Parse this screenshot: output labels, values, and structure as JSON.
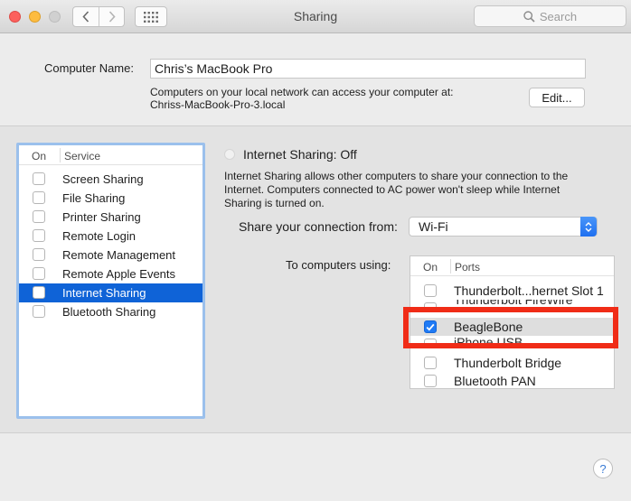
{
  "window": {
    "title": "Sharing"
  },
  "search": {
    "placeholder": "Search"
  },
  "computer_name": {
    "label": "Computer Name:",
    "value": "Chris’s MacBook Pro",
    "description_line1": "Computers on your local network can access your computer at:",
    "description_line2": "Chriss-MacBook-Pro-3.local",
    "edit_label": "Edit..."
  },
  "services": {
    "col_on": "On",
    "col_service": "Service",
    "items": [
      {
        "label": "Screen Sharing",
        "on": false,
        "selected": false
      },
      {
        "label": "File Sharing",
        "on": false,
        "selected": false
      },
      {
        "label": "Printer Sharing",
        "on": false,
        "selected": false
      },
      {
        "label": "Remote Login",
        "on": false,
        "selected": false
      },
      {
        "label": "Remote Management",
        "on": false,
        "selected": false
      },
      {
        "label": "Remote Apple Events",
        "on": false,
        "selected": false
      },
      {
        "label": "Internet Sharing",
        "on": false,
        "selected": true
      },
      {
        "label": "Bluetooth Sharing",
        "on": false,
        "selected": false
      }
    ]
  },
  "internet_sharing": {
    "status_title": "Internet Sharing: Off",
    "description": "Internet Sharing allows other computers to share your connection to the Internet. Computers connected to AC power won't sleep while Internet Sharing is turned on.",
    "share_from_label": "Share your connection from:",
    "share_from_value": "Wi-Fi",
    "to_computers_label": "To computers using:"
  },
  "ports": {
    "col_on": "On",
    "col_ports": "Ports",
    "items": [
      {
        "label": "Thunderbolt...hernet Slot 1",
        "on": false
      },
      {
        "label": "Thunderbolt FireWire",
        "on": false
      },
      {
        "label": "BeagleBone",
        "on": true
      },
      {
        "label": "iPhone USB",
        "on": false
      },
      {
        "label": "Thunderbolt Bridge",
        "on": false
      },
      {
        "label": "Bluetooth PAN",
        "on": false
      }
    ]
  },
  "help": {
    "label": "?"
  },
  "colors": {
    "selection": "#0f63d7",
    "highlight_box": "#f02c17",
    "checkbox_checked": "#1f7af5"
  }
}
